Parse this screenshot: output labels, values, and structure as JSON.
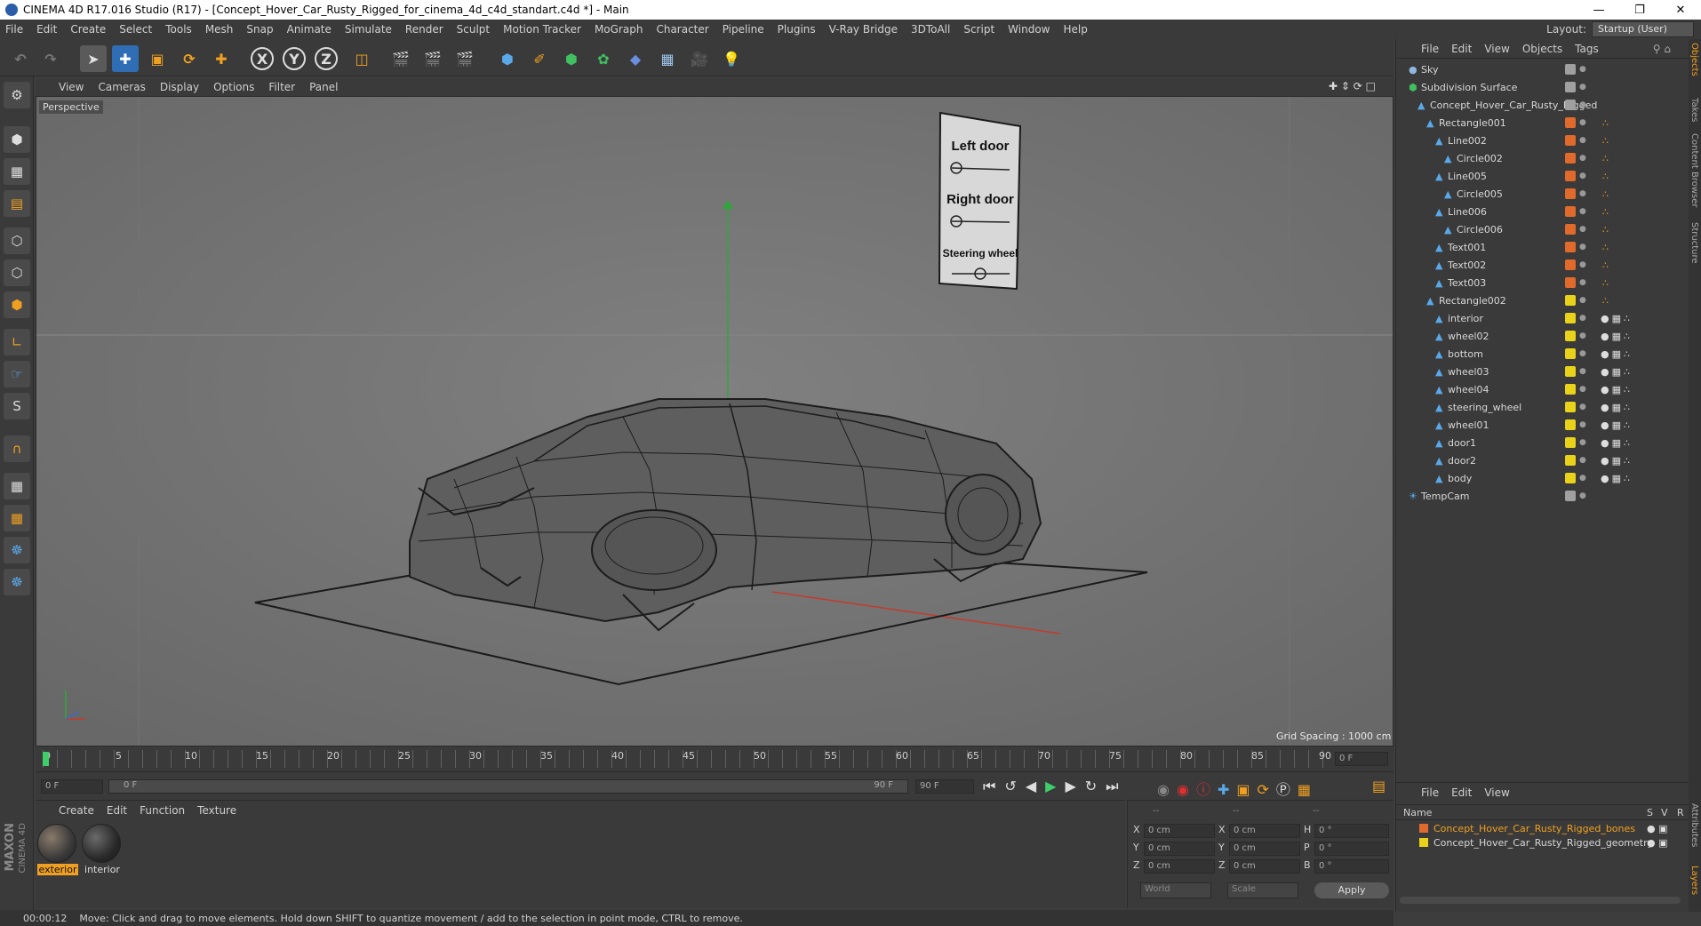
{
  "window": {
    "title": "CINEMA 4D R17.016 Studio (R17) - [Concept_Hover_Car_Rusty_Rigged_for_cinema_4d_c4d_standart.c4d *] - Main"
  },
  "menu": [
    "File",
    "Edit",
    "Create",
    "Select",
    "Tools",
    "Mesh",
    "Snap",
    "Animate",
    "Simulate",
    "Render",
    "Sculpt",
    "Motion Tracker",
    "MoGraph",
    "Character",
    "Pipeline",
    "Plugins",
    "V-Ray Bridge",
    "3DToAll",
    "Script",
    "Window",
    "Help"
  ],
  "layout": {
    "label": "Layout:",
    "value": "Startup (User)"
  },
  "viewport": {
    "menu": [
      "View",
      "Cameras",
      "Display",
      "Options",
      "Filter",
      "Panel"
    ],
    "label": "Perspective",
    "grid_spacing": "Grid Spacing : 1000 cm",
    "sign": {
      "left_door": "Left door",
      "right_door": "Right door",
      "steering": "Steering wheel"
    }
  },
  "timeline": {
    "ticks": [
      "0",
      "5",
      "10",
      "15",
      "20",
      "25",
      "30",
      "35",
      "40",
      "45",
      "50",
      "55",
      "60",
      "65",
      "70",
      "75",
      "80",
      "85",
      "90"
    ],
    "current_frame": "0 F",
    "start_field": "0 F",
    "range_start": "0 F",
    "range_end": "90 F",
    "end_field": "90 F"
  },
  "materials": {
    "menu": [
      "Create",
      "Edit",
      "Function",
      "Texture"
    ],
    "items": [
      {
        "name": "exterior"
      },
      {
        "name": "interior"
      }
    ]
  },
  "coords": {
    "headers": [
      "--",
      "--",
      "--"
    ],
    "rows": [
      {
        "a": "X",
        "av": "0 cm",
        "b": "X",
        "bv": "0 cm",
        "c": "H",
        "cv": "0 °"
      },
      {
        "a": "Y",
        "av": "0 cm",
        "b": "Y",
        "bv": "0 cm",
        "c": "P",
        "cv": "0 °"
      },
      {
        "a": "Z",
        "av": "0 cm",
        "b": "Z",
        "bv": "0 cm",
        "c": "B",
        "cv": "0 °"
      }
    ],
    "mode": "World",
    "scale": "Scale",
    "apply": "Apply"
  },
  "status": {
    "time": "00:00:12",
    "message": "Move: Click and drag to move elements. Hold down SHIFT to quantize movement / add to the selection in point mode, CTRL to remove."
  },
  "objects": {
    "menu": [
      "File",
      "Edit",
      "View",
      "Objects",
      "Tags"
    ],
    "rows": [
      {
        "name": "Sky",
        "color": "#a0a0a0"
      },
      {
        "name": "Subdivision Surface",
        "color": "#a0a0a0"
      },
      {
        "name": "Concept_Hover_Car_Rusty_Rigged",
        "color": "#a0a0a0"
      },
      {
        "name": "Rectangle001",
        "color": "#e06a2b"
      },
      {
        "name": "Line002",
        "color": "#e06a2b"
      },
      {
        "name": "Circle002",
        "color": "#e06a2b"
      },
      {
        "name": "Line005",
        "color": "#e06a2b"
      },
      {
        "name": "Circle005",
        "color": "#e06a2b"
      },
      {
        "name": "Line006",
        "color": "#e06a2b"
      },
      {
        "name": "Circle006",
        "color": "#e06a2b"
      },
      {
        "name": "Text001",
        "color": "#e06a2b"
      },
      {
        "name": "Text002",
        "color": "#e06a2b"
      },
      {
        "name": "Text003",
        "color": "#e06a2b"
      },
      {
        "name": "Rectangle002",
        "color": "#e8d21a"
      },
      {
        "name": "interior",
        "color": "#e8d21a"
      },
      {
        "name": "wheel02",
        "color": "#e8d21a"
      },
      {
        "name": "bottom",
        "color": "#e8d21a"
      },
      {
        "name": "wheel03",
        "color": "#e8d21a"
      },
      {
        "name": "wheel04",
        "color": "#e8d21a"
      },
      {
        "name": "steering_wheel",
        "color": "#e8d21a"
      },
      {
        "name": "wheel01",
        "color": "#e8d21a"
      },
      {
        "name": "door1",
        "color": "#e8d21a"
      },
      {
        "name": "door2",
        "color": "#e8d21a"
      },
      {
        "name": "body",
        "color": "#e8d21a"
      },
      {
        "name": "TempCam",
        "color": "#a0a0a0"
      }
    ]
  },
  "layers": {
    "menu": [
      "File",
      "Edit",
      "View"
    ],
    "columns": {
      "name": "Name",
      "s": "S",
      "v": "V",
      "r": "R"
    },
    "rows": [
      {
        "name": "Concept_Hover_Car_Rusty_Rigged_bones",
        "color": "#e06a2b",
        "text_color": "#f0a020"
      },
      {
        "name": "Concept_Hover_Car_Rusty_Rigged_geometry",
        "color": "#e8d21a",
        "text_color": "#d8d8d8"
      }
    ]
  },
  "side_tabs": [
    "Objects",
    "Takes",
    "Content Browser",
    "Structure",
    "Attributes",
    "Layers"
  ],
  "brand": {
    "maxon": "MAXON",
    "c4d": "CINEMA 4D"
  }
}
